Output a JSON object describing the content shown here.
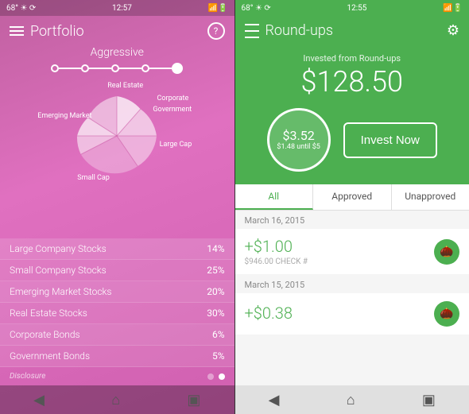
{
  "left": {
    "statusBar": {
      "left": "68° ☀ ⟳",
      "time": "12:57",
      "right": "▲ ▲ ◀ ▮▮▮ 🔋"
    },
    "header": {
      "title": "Portfolio",
      "menuIcon": "☰",
      "helpIcon": "?"
    },
    "chart": {
      "title": "Aggressive",
      "labels": {
        "realEstate": "Real Estate",
        "corporate": "Corporate",
        "government": "Government",
        "largeCap": "Large Cap",
        "smallCap": "Small Cap",
        "emergingMarket": "Emerging Market"
      }
    },
    "stocks": [
      {
        "name": "Large Company Stocks",
        "pct": "14%"
      },
      {
        "name": "Small Company Stocks",
        "pct": "25%"
      },
      {
        "name": "Emerging Market Stocks",
        "pct": "20%"
      },
      {
        "name": "Real Estate Stocks",
        "pct": "30%"
      },
      {
        "name": "Corporate Bonds",
        "pct": "6%"
      },
      {
        "name": "Government Bonds",
        "pct": "5%"
      }
    ],
    "footer": {
      "disclosure": "Disclosure"
    },
    "nav": {
      "back": "◀",
      "home": "⌂",
      "recent": "▣"
    }
  },
  "right": {
    "statusBar": {
      "left": "68° ☀ ⟳",
      "time": "12:55",
      "right": "▲ ▮▮▮ 🔋"
    },
    "header": {
      "title": "Round-ups",
      "menuIcon": "☰",
      "gearIcon": "⚙"
    },
    "hero": {
      "investedLabel": "Invested from Round-ups",
      "amount": "$128.50",
      "circleAmount": "$3.52",
      "circleSub": "$1.48 until $5",
      "investButton": "Invest Now"
    },
    "tabs": [
      {
        "label": "All",
        "active": true
      },
      {
        "label": "Approved",
        "active": false
      },
      {
        "label": "Unapproved",
        "active": false
      }
    ],
    "transactions": [
      {
        "date": "March 16, 2015",
        "amount": "+$1.00",
        "detail": "$946.00  CHECK #",
        "hasIcon": true
      },
      {
        "date": "March 15, 2015",
        "amount": "+$0.38",
        "detail": "",
        "hasIcon": true
      }
    ],
    "nav": {
      "back": "◀",
      "home": "⌂",
      "recent": "▣"
    }
  }
}
